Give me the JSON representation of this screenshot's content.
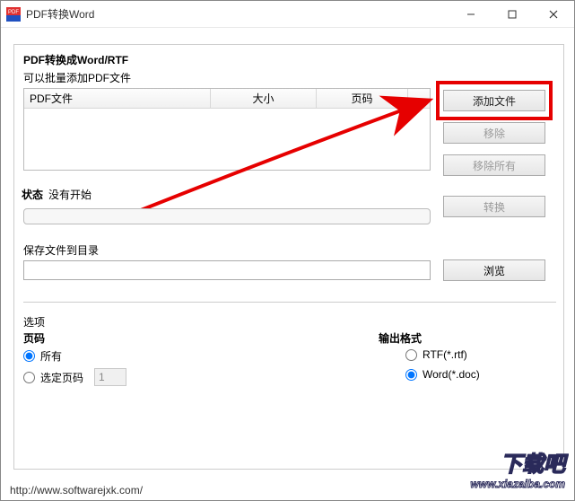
{
  "window": {
    "title": "PDF转换Word"
  },
  "header": {
    "title": "PDF转换成Word/RTF",
    "sub": "可以批量添加PDF文件"
  },
  "table": {
    "cols": {
      "file": "PDF文件",
      "size": "大小",
      "page": "页码"
    }
  },
  "buttons": {
    "add": "添加文件",
    "remove": "移除",
    "removeall": "移除所有",
    "convert": "转换",
    "browse": "浏览"
  },
  "status": {
    "label": "状态",
    "value": "没有开始"
  },
  "save": {
    "label": "保存文件到目录",
    "value": ""
  },
  "options": {
    "label": "选项",
    "page_label": "页码",
    "all": "所有",
    "sel": "选定页码",
    "sel_value": "1",
    "fmt_label": "输出格式",
    "rtf": "RTF(*.rtf)",
    "doc": "Word(*.doc)"
  },
  "footer": {
    "url": "http://www.softwarejxk.com/"
  },
  "watermark": {
    "line1": "下载吧",
    "line2": "www.xiazaiba.com"
  }
}
